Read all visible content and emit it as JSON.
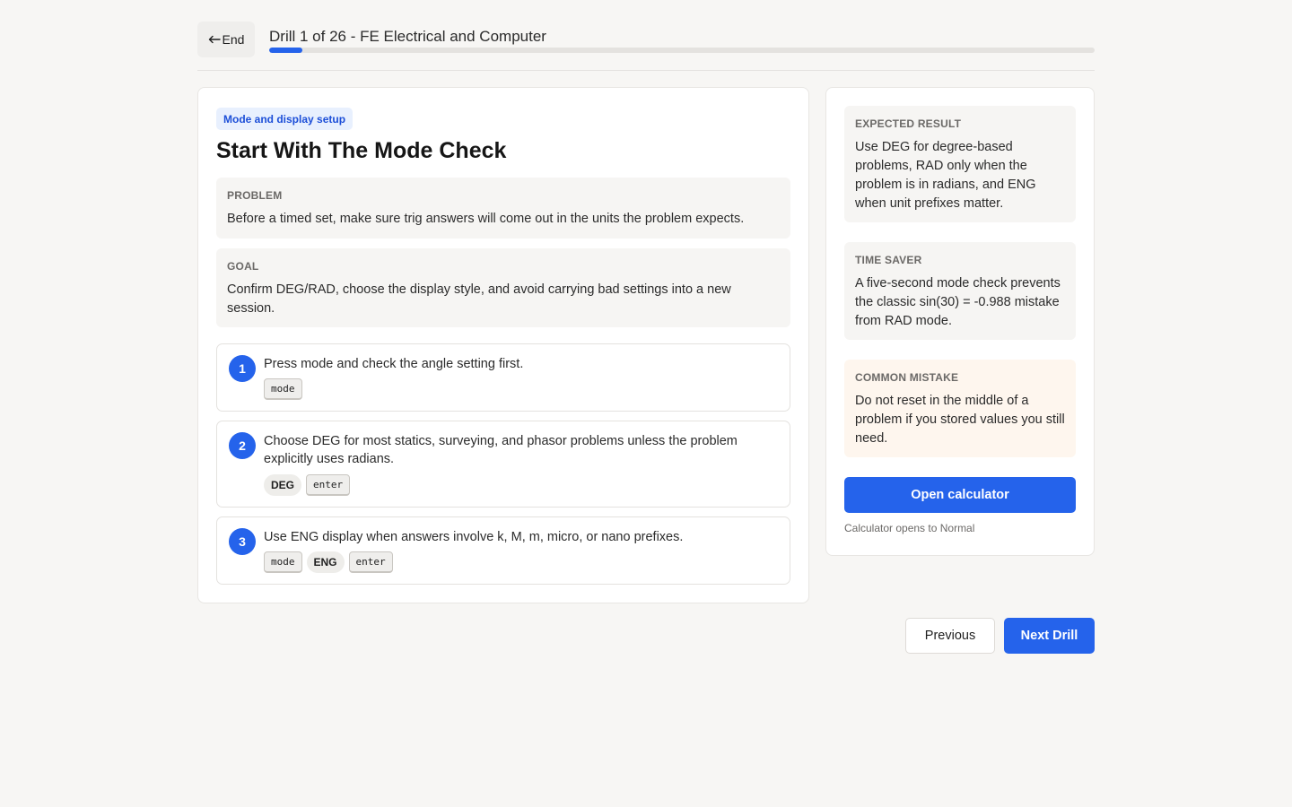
{
  "header": {
    "end_label": "End",
    "end_icon": "arrow-left-icon",
    "drill_title": "Drill 1 of 26 - FE Electrical and Computer",
    "progress_fraction": 0.04
  },
  "main": {
    "tag": "Mode and display setup",
    "heading": "Start With The Mode Check",
    "problem": {
      "label": "PROBLEM",
      "text": "Before a timed set, make sure trig answers will come out in the units the problem expects."
    },
    "goal": {
      "label": "GOAL",
      "text": "Confirm DEG/RAD, choose the display style, and avoid carrying bad settings into a new session."
    },
    "steps": [
      {
        "number": "1",
        "text": "Press mode and check the angle setting first.",
        "keys": [
          {
            "text": "mode",
            "kind": "btn"
          }
        ]
      },
      {
        "number": "2",
        "text": "Choose DEG for most statics, surveying, and phasor problems unless the problem explicitly uses radians.",
        "keys": [
          {
            "text": "DEG",
            "kind": "lbl"
          },
          {
            "text": "enter",
            "kind": "btn"
          }
        ]
      },
      {
        "number": "3",
        "text": "Use ENG display when answers involve k, M, m, micro, or nano prefixes.",
        "keys": [
          {
            "text": "mode",
            "kind": "btn"
          },
          {
            "text": "ENG",
            "kind": "lbl"
          },
          {
            "text": "enter",
            "kind": "btn"
          }
        ]
      }
    ]
  },
  "side": {
    "expected": {
      "label": "EXPECTED RESULT",
      "text": "Use DEG for degree-based problems, RAD only when the problem is in radians, and ENG when unit prefixes matter."
    },
    "time_saver": {
      "label": "TIME SAVER",
      "text": "A five-second mode check prevents the classic sin(30) = -0.988 mistake from RAD mode."
    },
    "common_mistake": {
      "label": "COMMON MISTAKE",
      "text": "Do not reset in the middle of a problem if you stored values you still need."
    },
    "open_button": "Open calculator",
    "calc_note": "Calculator opens to Normal"
  },
  "footer": {
    "previous_label": "Previous",
    "next_label": "Next Drill"
  },
  "colors": {
    "accent": "#2563eb",
    "background": "#f7f6f4",
    "warn_bg": "#fef6ee"
  }
}
